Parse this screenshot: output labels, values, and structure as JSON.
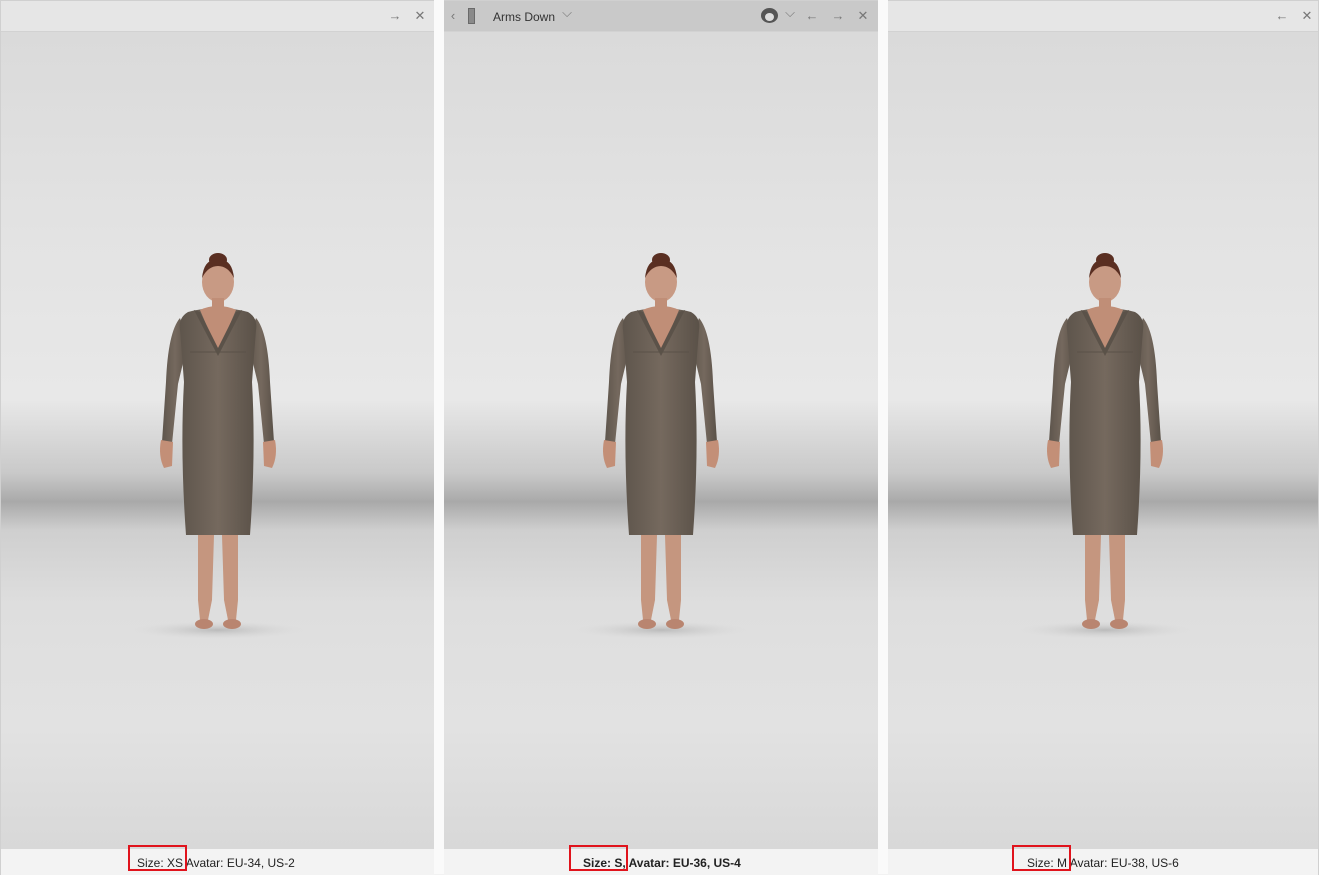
{
  "panels": [
    {
      "footer": {
        "size_label": "Size: XS",
        "avatar_label": " Avatar: EU-34, US-2"
      },
      "toolbar": {
        "forward": "→",
        "close": "✕"
      }
    },
    {
      "toolbar": {
        "prev": "‹",
        "pose_label": "Arms Down",
        "pose_caret": "⌵",
        "avatar_caret": "⌵",
        "back": "←",
        "forward": "→",
        "close": "✕"
      },
      "footer": {
        "size_label": "Size: S,",
        "avatar_label": " Avatar: EU-36, US-4"
      }
    },
    {
      "footer": {
        "size_label": "Size: M",
        "avatar_label": " Avatar: EU-38, US-6"
      },
      "toolbar": {
        "back": "←",
        "close": "✕"
      }
    }
  ],
  "icons": [
    "arrow-right-icon",
    "close-icon",
    "chevron-left-icon",
    "ruler-icon",
    "chevron-down-icon",
    "avatar-face-icon",
    "arrow-left-icon"
  ],
  "colors": {
    "highlight": "#e0131c",
    "dress": "#6d6359",
    "skin": "#c9977e",
    "hair": "#5a2f22"
  }
}
